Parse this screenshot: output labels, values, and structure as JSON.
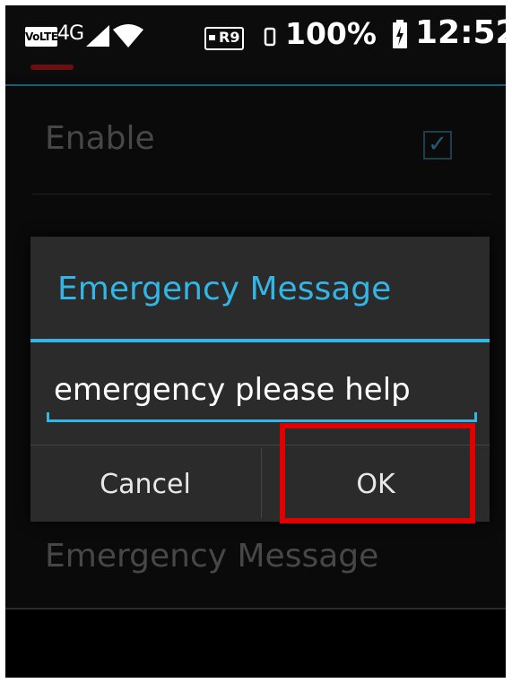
{
  "status_bar": {
    "volte": "VoLTE",
    "network": "4G",
    "roaming": "R9",
    "battery_percent": "100%",
    "time": "12:52"
  },
  "settings": {
    "enable_label": "Enable",
    "enable_checked": true,
    "emergency_message_label": "Emergency Message"
  },
  "dialog": {
    "title": "Emergency Message",
    "input_value": "emergency please help",
    "cancel_label": "Cancel",
    "ok_label": "OK"
  },
  "colors": {
    "accent": "#33b5e5",
    "highlight": "#e00000",
    "dialog_bg": "#2b2b2b",
    "screen_bg": "#0a0a0a"
  }
}
